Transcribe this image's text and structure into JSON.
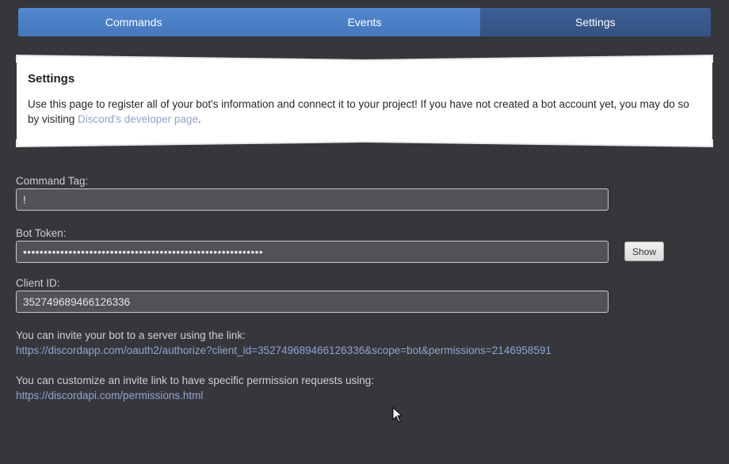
{
  "tabs": [
    {
      "label": "Commands",
      "active": false
    },
    {
      "label": "Events",
      "active": false
    },
    {
      "label": "Settings",
      "active": true
    }
  ],
  "info_card": {
    "title": "Settings",
    "text_before_link": "Use this page to register all of your bot's information and connect it to your project! If you have not created a bot account yet, you may do so by visiting ",
    "link_text": "Discord's developer page",
    "text_after_link": "."
  },
  "form": {
    "command_tag": {
      "label": "Command Tag:",
      "value": "!"
    },
    "bot_token": {
      "label": "Bot Token:",
      "value": "••••••••••••••••••••••••••••••••••••••••••••••••••••••••••",
      "show_label": "Show"
    },
    "client_id": {
      "label": "Client ID:",
      "value": "352749689466126336"
    }
  },
  "invite": {
    "text": "You can invite your bot to a server using the link:",
    "url": "https://discordapp.com/oauth2/authorize?client_id=352749689466126336&scope=bot&permissions=2146958591"
  },
  "permissions": {
    "text": "You can customize an invite link to have specific permission requests using:",
    "url": "https://discordapi.com/permissions.html"
  },
  "colors": {
    "background": "#36373b",
    "tab": "#4a7fc6",
    "tab_active": "#345384",
    "link": "#8fa4d4"
  }
}
